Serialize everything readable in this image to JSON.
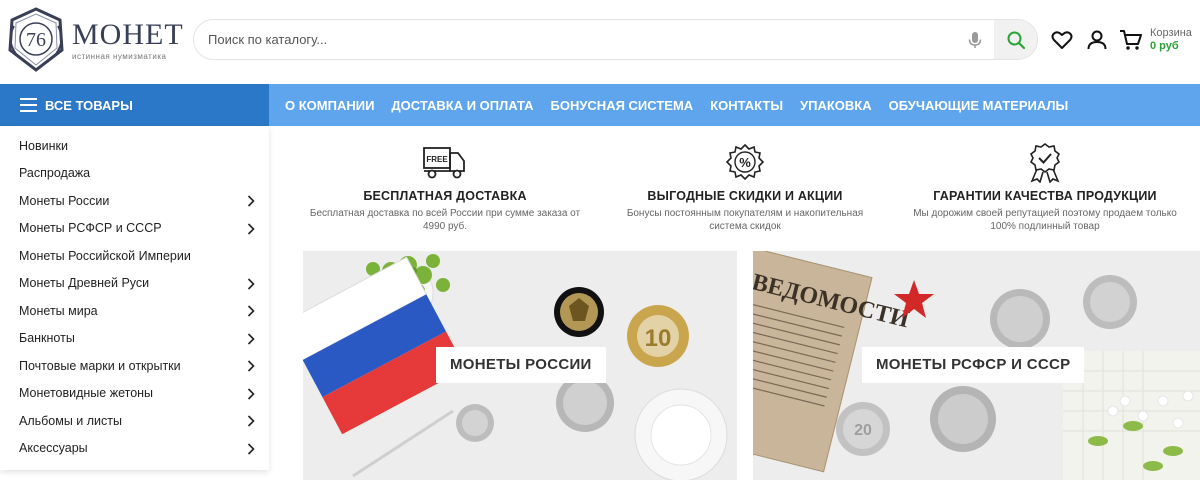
{
  "header": {
    "logo_number": "76",
    "logo_title": "МОНЕТ",
    "logo_subtitle": "истинная нумизматика",
    "search_placeholder": "Поиск по каталогу...",
    "cart_label": "Корзина",
    "cart_sum": "0 руб"
  },
  "nav": {
    "all_goods": "ВСЕ ТОВАРЫ",
    "links": [
      "О КОМПАНИИ",
      "ДОСТАВКА И ОПЛАТА",
      "БОНУСНАЯ СИСТЕМА",
      "КОНТАКТЫ",
      "УПАКОВКА",
      "ОБУЧАЮЩИЕ МАТЕРИАЛЫ"
    ]
  },
  "sidebar": {
    "items": [
      {
        "label": "Новинки"
      },
      {
        "label": "Распродажа"
      },
      {
        "label": "Монеты России"
      },
      {
        "label": "Монеты РСФСР и СССР"
      },
      {
        "label": "Монеты Российской Империи"
      },
      {
        "label": "Монеты Древней Руси"
      },
      {
        "label": "Монеты мира"
      },
      {
        "label": "Банкноты"
      },
      {
        "label": "Почтовые марки и открытки"
      },
      {
        "label": "Монетовидные жетоны"
      },
      {
        "label": "Альбомы и листы"
      },
      {
        "label": "Аксессуары"
      }
    ]
  },
  "features": [
    {
      "title": "БЕСПЛАТНАЯ ДОСТАВКА",
      "line1": "Бесплатная доставка по всей России при сумме заказа от",
      "line2": "4990 руб.",
      "icon": "truck-icon",
      "badge": "FREE"
    },
    {
      "title": "ВЫГОДНЫЕ СКИДКИ И АКЦИИ",
      "line1": "Бонусы постоянным покупателям и накопительная",
      "line2": "система скидок",
      "icon": "discount-badge-icon",
      "badge": "%"
    },
    {
      "title": "ГАРАНТИИ КАЧЕСТВА ПРОДУКЦИИ",
      "line1": "Мы дорожим своей репутацией поэтому продаем только",
      "line2": "100% подлинный товар",
      "icon": "quality-medal-icon"
    }
  ],
  "banners": [
    {
      "label": "МОНЕТЫ РОССИИ",
      "coin_value": "10"
    },
    {
      "label": "МОНЕТЫ РСФСР И СССР",
      "coin_value": "20",
      "newspaper_text": "ВЕДОМОСТИ"
    }
  ],
  "colors": {
    "nav_blue": "#5ea5ee",
    "nav_dark_blue": "#2c78c8",
    "accent_green": "#2aa336",
    "logo_navy": "#3a3f58"
  }
}
